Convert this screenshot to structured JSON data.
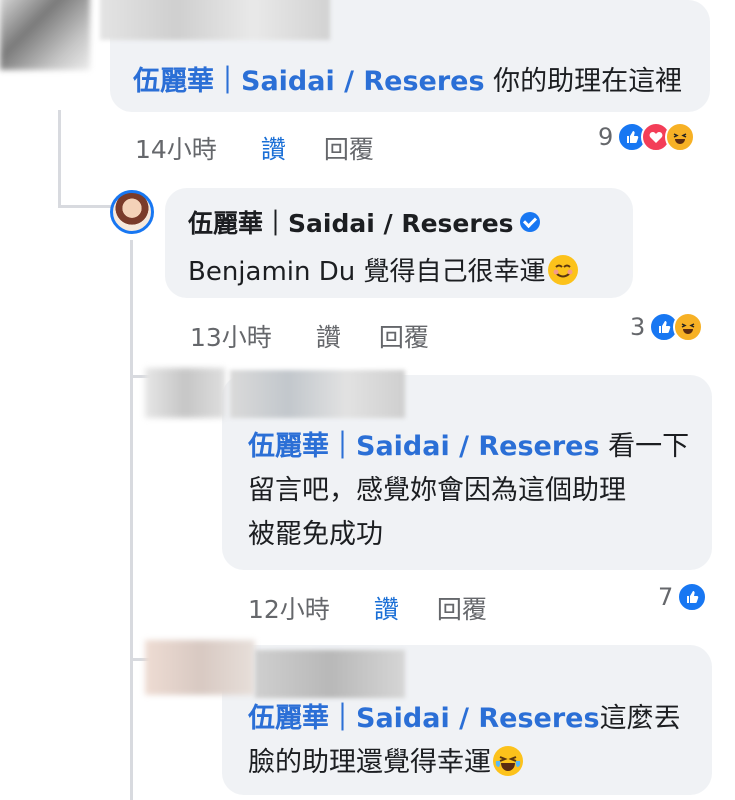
{
  "comments": [
    {
      "author_redacted": true,
      "mention": "伍麗華｜Saidai / Reseres",
      "text": " 你的助理在這裡",
      "time": "14小時",
      "like_label": "讚",
      "reply_label": "回覆",
      "reaction_count": "9",
      "reactions": [
        "like",
        "love",
        "haha"
      ]
    },
    {
      "author": "伍麗華｜Saidai / Reseres",
      "verified": true,
      "text": "Benjamin Du 覺得自己很幸運",
      "trailing_emoji": "smiling-face-emoji",
      "time": "13小時",
      "like_label": "讚",
      "reply_label": "回覆",
      "reaction_count": "3",
      "reactions": [
        "like",
        "haha"
      ]
    },
    {
      "author_redacted": true,
      "mention": "伍麗華｜Saidai / Reseres",
      "text_line1": " 看一下",
      "text_line2": "留言吧，感覺妳會因為這個助理",
      "text_line3": "被罷免成功",
      "time": "12小時",
      "like_label": "讚",
      "reply_label": "回覆",
      "reaction_count": "7",
      "reactions": [
        "like"
      ]
    },
    {
      "author_redacted": true,
      "mention": "伍麗華｜Saidai / Reseres",
      "text_line1": "這麼丟",
      "text_line2": "臉的助理還覺得幸運",
      "trailing_emoji": "crying-laughing-face-emoji"
    }
  ],
  "colors": {
    "bubble": "#f0f2f5",
    "mention": "#2b6fd6",
    "like_blue": "#1877f2",
    "muted_text": "#65676b"
  }
}
